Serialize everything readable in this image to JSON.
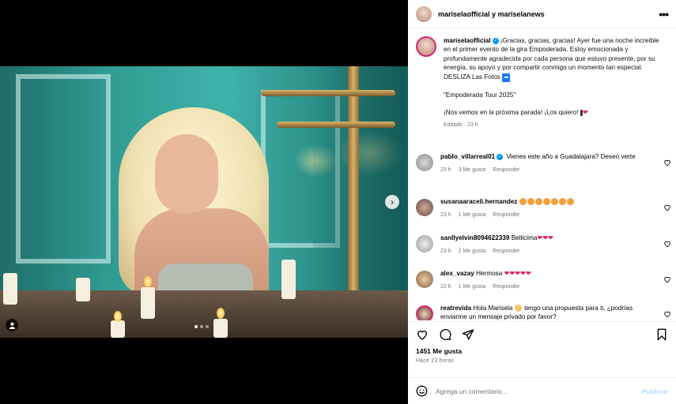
{
  "post": {
    "header_title": "mariselaofficial y mariselanews",
    "more_label": "•••"
  },
  "caption": {
    "username": "mariselaofficial",
    "lines": [
      "¡Gracias, gracias, gracias! Ayer fue una noche increíble en el primer evento de la gira Empoderada. Estoy emocionada y profundamente agradecida por cada persona que estuvo presente, por su energía, su apoyo y por compartir conmigo un momento tan especial. DESLIZA Las Fotos",
      "\"Empoderada Tour 2025\"",
      "¡Nos vemos en la próxima parada! ¡Los quiero!"
    ],
    "arrow": "➡",
    "emoji_end": "❤",
    "meta": "Editado · 23 h"
  },
  "comments": [
    {
      "username": "pablo_villarreal01",
      "verified": true,
      "text": "Vienes este año a Guadalajara? Deseo verte",
      "time": "23 h",
      "likes": "3 Me gusta",
      "reply": "Responder"
    },
    {
      "username": "susanaaraceli.hernandez",
      "verified": false,
      "text": "",
      "emoji_count": 7,
      "time": "23 h",
      "likes": "1 Me gusta",
      "reply": "Responder"
    },
    {
      "username": "sanllyelvin8094622339",
      "verified": false,
      "text": "Bellicima",
      "hearts": "❤❤❤",
      "time": "23 h",
      "likes": "2 Me gusta",
      "reply": "Responder"
    },
    {
      "username": "alex_vazay",
      "verified": false,
      "text": "Hermosa",
      "hearts": "❤❤❤❤❤",
      "time": "22 h",
      "likes": "1 Me gusta",
      "reply": "Responder"
    },
    {
      "username": "reatrevida",
      "verified": false,
      "text": "Hola Marisela",
      "text2": "tengo una propuesta para ti, ¿podrías enviarme un mensaje privado por favor?",
      "time": "",
      "likes": "",
      "reply": ""
    }
  ],
  "stats": {
    "likes": "1451 Me gusta",
    "time": "Hace 23 horas"
  },
  "composer": {
    "placeholder": "Agrega un comentario...",
    "publish": "Publicar"
  },
  "colors": {
    "accent": "#0095f6",
    "heart": "#e0245e",
    "muted": "#737373"
  },
  "icons": [
    "heart-icon",
    "comment-icon",
    "share-icon",
    "bookmark-icon",
    "emoji-icon",
    "more-icon",
    "chevron-right-icon",
    "user-tag-icon",
    "verified-badge-icon"
  ]
}
